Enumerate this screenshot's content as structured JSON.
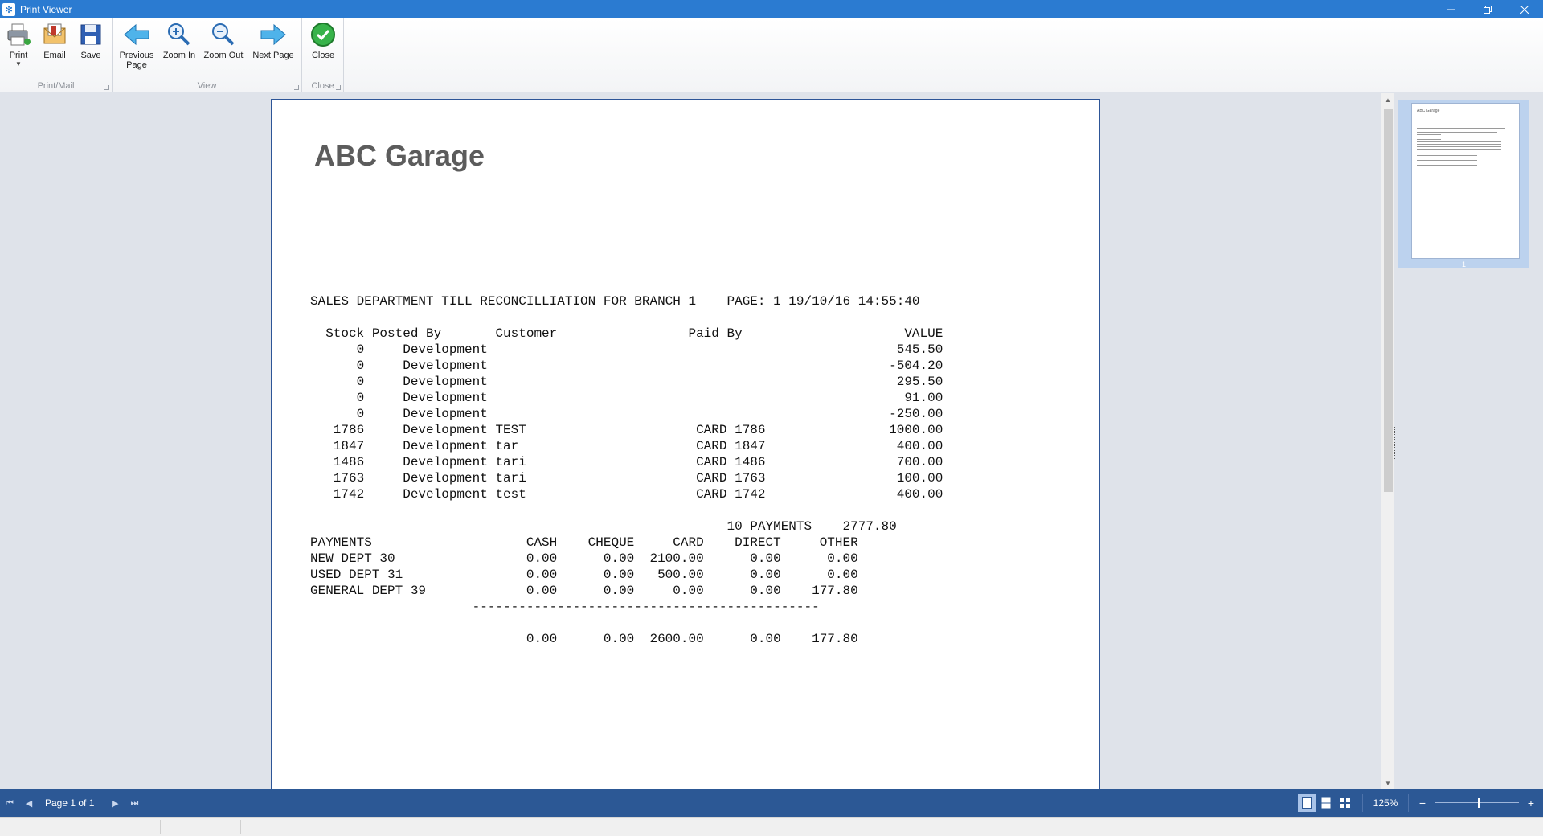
{
  "window": {
    "title": "Print Viewer",
    "app_icon": "snowflake-icon"
  },
  "ribbon": {
    "groups": [
      {
        "label": "Print/Mail"
      },
      {
        "label": "View"
      },
      {
        "label": "Close"
      }
    ],
    "buttons": {
      "print": "Print",
      "email": "Email",
      "save": "Save",
      "previous_page_line1": "Previous",
      "previous_page_line2": "Page",
      "zoom_in": "Zoom In",
      "zoom_out": "Zoom Out",
      "next_page": "Next Page",
      "close": "Close"
    }
  },
  "report": {
    "company": "ABC Garage",
    "lines": [
      "SALES DEPARTMENT TILL RECONCILLIATION FOR BRANCH 1    PAGE: 1 19/10/16 14:55:40",
      "",
      "  Stock Posted By       Customer                 Paid By                     VALUE",
      "      0     Development                                                     545.50",
      "      0     Development                                                    -504.20",
      "      0     Development                                                     295.50",
      "      0     Development                                                      91.00",
      "      0     Development                                                    -250.00",
      "   1786     Development TEST                      CARD 1786                1000.00",
      "   1847     Development tar                       CARD 1847                 400.00",
      "   1486     Development tari                      CARD 1486                 700.00",
      "   1763     Development tari                      CARD 1763                 100.00",
      "   1742     Development test                      CARD 1742                 400.00",
      "",
      "                                                      10 PAYMENTS    2777.80",
      "PAYMENTS                    CASH    CHEQUE     CARD    DIRECT     OTHER",
      "NEW DEPT 30                 0.00      0.00  2100.00      0.00      0.00",
      "USED DEPT 31                0.00      0.00   500.00      0.00      0.00",
      "GENERAL DEPT 39             0.00      0.00     0.00      0.00    177.80",
      "                     ---------------------------------------------",
      "",
      "                            0.00      0.00  2600.00      0.00    177.80"
    ]
  },
  "thumbnail": {
    "title": "ABC Garage",
    "page_number": "1"
  },
  "navbar": {
    "page_label": "Page 1 of 1",
    "zoom_label": "125%",
    "zoom_level_percent": 125,
    "zoom_minus": "−",
    "zoom_plus": "+"
  },
  "colors": {
    "title_bar": "#2b7bd1",
    "nav_bar": "#2c5895",
    "page_border": "#2d5597"
  }
}
